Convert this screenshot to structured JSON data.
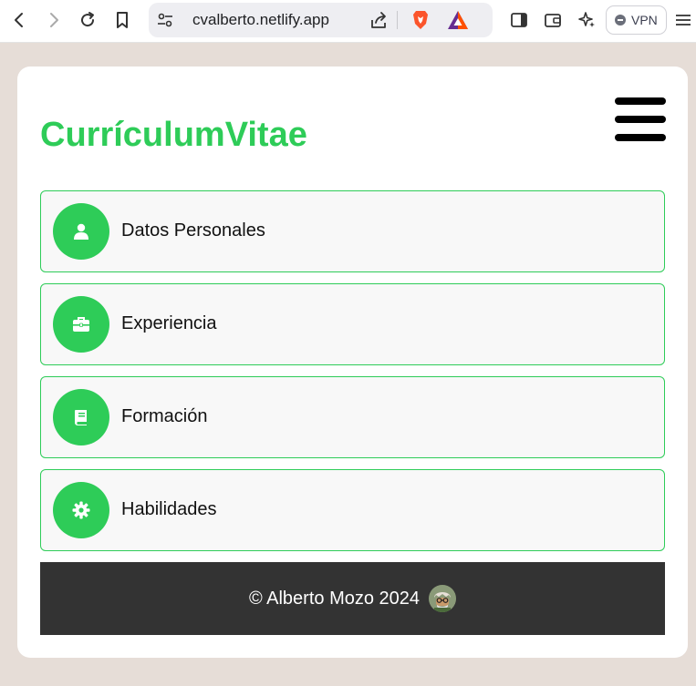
{
  "browser": {
    "url": "cvalberto.netlify.app",
    "vpn_label": "VPN",
    "icons": {
      "back": "back-arrow-icon",
      "forward": "forward-arrow-icon",
      "reload": "reload-icon",
      "bookmark": "bookmark-icon",
      "site_settings": "tune-icon",
      "share": "share-icon",
      "brave": "brave-shield-icon",
      "rewards": "brave-rewards-icon",
      "sidebar": "sidebar-icon",
      "wallet": "wallet-icon",
      "leo": "leo-ai-icon",
      "menu": "browser-menu-icon"
    }
  },
  "page": {
    "title": "CurrículumVitae",
    "menu_icon": "hamburger-icon",
    "sections": [
      {
        "label": "Datos Personales",
        "icon": "user-icon"
      },
      {
        "label": "Experiencia",
        "icon": "briefcase-icon"
      },
      {
        "label": "Formación",
        "icon": "book-icon"
      },
      {
        "label": "Habilidades",
        "icon": "gear-icon"
      }
    ],
    "footer": {
      "copyright": "© Alberto Mozo 2024",
      "avatar_icon": "avatar-image"
    }
  },
  "colors": {
    "accent": "#2ecc58",
    "footer_bg": "#333333",
    "page_bg": "#e6ddd7"
  }
}
